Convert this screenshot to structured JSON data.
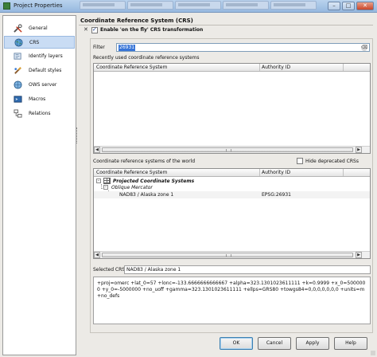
{
  "window": {
    "title": "Project Properties",
    "buttons": {
      "minimize": "–",
      "maximize": "□",
      "close": "✕"
    }
  },
  "sidebar": {
    "items": [
      {
        "label": "General",
        "icon": "wrench-screwdriver-icon",
        "selected": false
      },
      {
        "label": "CRS",
        "icon": "globe-icon",
        "selected": true
      },
      {
        "label": "Identify layers",
        "icon": "identify-icon",
        "selected": false
      },
      {
        "label": "Default styles",
        "icon": "brush-icon",
        "selected": false
      },
      {
        "label": "OWS server",
        "icon": "server-icon",
        "selected": false
      },
      {
        "label": "Macros",
        "icon": "macro-icon",
        "selected": false
      },
      {
        "label": "Relations",
        "icon": "relations-icon",
        "selected": false
      }
    ]
  },
  "crs": {
    "section_title": "Coordinate Reference System (CRS)",
    "otf_collapse": "✕",
    "otf_label": "Enable 'on the fly' CRS transformation",
    "otf_checked": true,
    "filter_label": "Filter",
    "filter_value": "26931",
    "recent_label": "Recently used coordinate reference systems",
    "recent_columns": [
      "Coordinate Reference System",
      "Authority ID"
    ],
    "world_label": "Coordinate reference systems of the world",
    "hide_deprecated_label": "Hide deprecated CRSs",
    "hide_deprecated_checked": false,
    "world_columns": [
      "Coordinate Reference System",
      "Authority ID"
    ],
    "tree": {
      "group": "Projected Coordinate Systems",
      "subgroup": "Oblique Mercator",
      "item_name": "NAD83 / Alaska zone 1",
      "item_authority": "EPSG:26931"
    },
    "selected_crs_label": "Selected CRS:",
    "selected_crs_value": "NAD83 / Alaska zone 1",
    "proj_string": "+proj=omerc +lat_0=57 +lonc=-133.6666666666667 +alpha=323.1301023611111 +k=0.9999 +x_0=5000000 +y_0=-5000000 +no_uoff +gamma=323.1301023611111 +ellps=GRS80 +towgs84=0,0,0,0,0,0,0 +units=m +no_defs"
  },
  "footer": {
    "ok": "OK",
    "cancel": "Cancel",
    "apply": "Apply",
    "help": "Help"
  }
}
